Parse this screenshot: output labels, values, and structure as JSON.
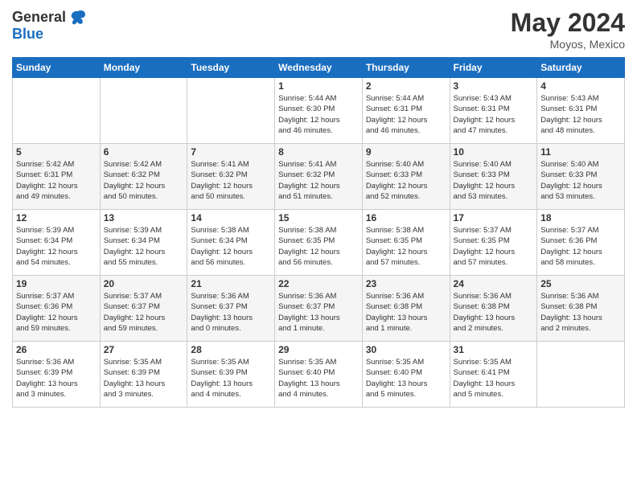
{
  "header": {
    "logo_general": "General",
    "logo_blue": "Blue",
    "month": "May 2024",
    "location": "Moyos, Mexico"
  },
  "days_of_week": [
    "Sunday",
    "Monday",
    "Tuesday",
    "Wednesday",
    "Thursday",
    "Friday",
    "Saturday"
  ],
  "weeks": [
    [
      {
        "num": "",
        "info": ""
      },
      {
        "num": "",
        "info": ""
      },
      {
        "num": "",
        "info": ""
      },
      {
        "num": "1",
        "info": "Sunrise: 5:44 AM\nSunset: 6:30 PM\nDaylight: 12 hours\nand 46 minutes."
      },
      {
        "num": "2",
        "info": "Sunrise: 5:44 AM\nSunset: 6:31 PM\nDaylight: 12 hours\nand 46 minutes."
      },
      {
        "num": "3",
        "info": "Sunrise: 5:43 AM\nSunset: 6:31 PM\nDaylight: 12 hours\nand 47 minutes."
      },
      {
        "num": "4",
        "info": "Sunrise: 5:43 AM\nSunset: 6:31 PM\nDaylight: 12 hours\nand 48 minutes."
      }
    ],
    [
      {
        "num": "5",
        "info": "Sunrise: 5:42 AM\nSunset: 6:31 PM\nDaylight: 12 hours\nand 49 minutes."
      },
      {
        "num": "6",
        "info": "Sunrise: 5:42 AM\nSunset: 6:32 PM\nDaylight: 12 hours\nand 50 minutes."
      },
      {
        "num": "7",
        "info": "Sunrise: 5:41 AM\nSunset: 6:32 PM\nDaylight: 12 hours\nand 50 minutes."
      },
      {
        "num": "8",
        "info": "Sunrise: 5:41 AM\nSunset: 6:32 PM\nDaylight: 12 hours\nand 51 minutes."
      },
      {
        "num": "9",
        "info": "Sunrise: 5:40 AM\nSunset: 6:33 PM\nDaylight: 12 hours\nand 52 minutes."
      },
      {
        "num": "10",
        "info": "Sunrise: 5:40 AM\nSunset: 6:33 PM\nDaylight: 12 hours\nand 53 minutes."
      },
      {
        "num": "11",
        "info": "Sunrise: 5:40 AM\nSunset: 6:33 PM\nDaylight: 12 hours\nand 53 minutes."
      }
    ],
    [
      {
        "num": "12",
        "info": "Sunrise: 5:39 AM\nSunset: 6:34 PM\nDaylight: 12 hours\nand 54 minutes."
      },
      {
        "num": "13",
        "info": "Sunrise: 5:39 AM\nSunset: 6:34 PM\nDaylight: 12 hours\nand 55 minutes."
      },
      {
        "num": "14",
        "info": "Sunrise: 5:38 AM\nSunset: 6:34 PM\nDaylight: 12 hours\nand 56 minutes."
      },
      {
        "num": "15",
        "info": "Sunrise: 5:38 AM\nSunset: 6:35 PM\nDaylight: 12 hours\nand 56 minutes."
      },
      {
        "num": "16",
        "info": "Sunrise: 5:38 AM\nSunset: 6:35 PM\nDaylight: 12 hours\nand 57 minutes."
      },
      {
        "num": "17",
        "info": "Sunrise: 5:37 AM\nSunset: 6:35 PM\nDaylight: 12 hours\nand 57 minutes."
      },
      {
        "num": "18",
        "info": "Sunrise: 5:37 AM\nSunset: 6:36 PM\nDaylight: 12 hours\nand 58 minutes."
      }
    ],
    [
      {
        "num": "19",
        "info": "Sunrise: 5:37 AM\nSunset: 6:36 PM\nDaylight: 12 hours\nand 59 minutes."
      },
      {
        "num": "20",
        "info": "Sunrise: 5:37 AM\nSunset: 6:37 PM\nDaylight: 12 hours\nand 59 minutes."
      },
      {
        "num": "21",
        "info": "Sunrise: 5:36 AM\nSunset: 6:37 PM\nDaylight: 13 hours\nand 0 minutes."
      },
      {
        "num": "22",
        "info": "Sunrise: 5:36 AM\nSunset: 6:37 PM\nDaylight: 13 hours\nand 1 minute."
      },
      {
        "num": "23",
        "info": "Sunrise: 5:36 AM\nSunset: 6:38 PM\nDaylight: 13 hours\nand 1 minute."
      },
      {
        "num": "24",
        "info": "Sunrise: 5:36 AM\nSunset: 6:38 PM\nDaylight: 13 hours\nand 2 minutes."
      },
      {
        "num": "25",
        "info": "Sunrise: 5:36 AM\nSunset: 6:38 PM\nDaylight: 13 hours\nand 2 minutes."
      }
    ],
    [
      {
        "num": "26",
        "info": "Sunrise: 5:36 AM\nSunset: 6:39 PM\nDaylight: 13 hours\nand 3 minutes."
      },
      {
        "num": "27",
        "info": "Sunrise: 5:35 AM\nSunset: 6:39 PM\nDaylight: 13 hours\nand 3 minutes."
      },
      {
        "num": "28",
        "info": "Sunrise: 5:35 AM\nSunset: 6:39 PM\nDaylight: 13 hours\nand 4 minutes."
      },
      {
        "num": "29",
        "info": "Sunrise: 5:35 AM\nSunset: 6:40 PM\nDaylight: 13 hours\nand 4 minutes."
      },
      {
        "num": "30",
        "info": "Sunrise: 5:35 AM\nSunset: 6:40 PM\nDaylight: 13 hours\nand 5 minutes."
      },
      {
        "num": "31",
        "info": "Sunrise: 5:35 AM\nSunset: 6:41 PM\nDaylight: 13 hours\nand 5 minutes."
      },
      {
        "num": "",
        "info": ""
      }
    ]
  ]
}
